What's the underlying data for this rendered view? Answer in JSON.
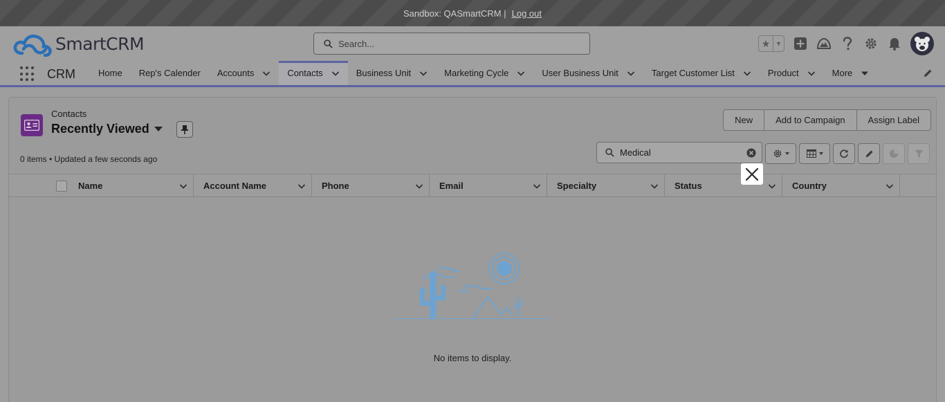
{
  "sandbox": {
    "label": "Sandbox: QASmartCRM |",
    "logout": "Log out"
  },
  "header": {
    "brand": "SmartCRM",
    "search_placeholder": "Search..."
  },
  "icons": [
    "favorite-star-icon",
    "plus-icon",
    "trailhead-icon",
    "help-icon",
    "setup-gear-icon",
    "bell-icon",
    "avatar-icon"
  ],
  "nav": {
    "app_name": "CRM",
    "items": [
      {
        "label": "Home",
        "dropdown": false
      },
      {
        "label": "Rep's Calender",
        "dropdown": false
      },
      {
        "label": "Accounts",
        "dropdown": true
      },
      {
        "label": "Contacts",
        "dropdown": true,
        "active": true
      },
      {
        "label": "Business Unit",
        "dropdown": true
      },
      {
        "label": "Marketing Cycle",
        "dropdown": true
      },
      {
        "label": "User Business Unit",
        "dropdown": true
      },
      {
        "label": "Target Customer List",
        "dropdown": true
      },
      {
        "label": "Product",
        "dropdown": true
      },
      {
        "label": "More",
        "dropdown": true
      }
    ]
  },
  "list": {
    "object_label": "Contacts",
    "view_name": "Recently Viewed",
    "actions": [
      "New",
      "Add to Campaign",
      "Assign Label"
    ],
    "meta": "0 items • Updated a few seconds ago",
    "search_value": "Medical",
    "columns": [
      "Name",
      "Account Name",
      "Phone",
      "Email",
      "Specialty",
      "Status",
      "Country"
    ],
    "empty_message": "No items to display."
  },
  "colors": {
    "accent": "#5b62a0",
    "object_icon": "#6a2b86",
    "illustration": "#6fa3cf"
  }
}
